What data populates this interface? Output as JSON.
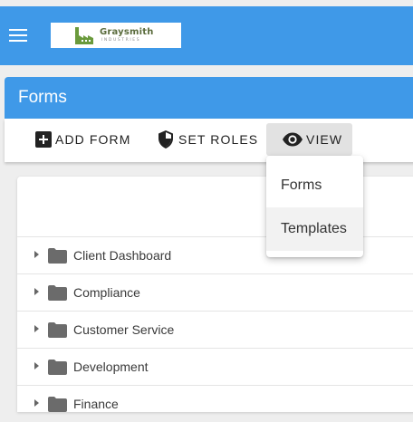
{
  "app": {
    "logo_name": "Graysmith",
    "logo_subtitle": "INDUSTRIES"
  },
  "page": {
    "title": "Forms"
  },
  "toolbar": {
    "add_form_label": "ADD FORM",
    "set_roles_label": "SET ROLES",
    "view_label": "VIEW"
  },
  "view_menu": {
    "items": [
      {
        "label": "Forms"
      },
      {
        "label": "Templates",
        "highlighted": true
      }
    ]
  },
  "folders": [
    {
      "label": "Client Dashboard"
    },
    {
      "label": "Compliance"
    },
    {
      "label": "Customer Service"
    },
    {
      "label": "Development"
    },
    {
      "label": "Finance"
    }
  ],
  "colors": {
    "primary": "#3f99e8",
    "logo_green": "#6a9a3c",
    "folder_gray": "#6b6b6b"
  },
  "icons": [
    "menu-icon",
    "factory-logo-icon",
    "add-box-icon",
    "shield-icon",
    "eye-icon",
    "caret-right-icon",
    "folder-icon"
  ]
}
